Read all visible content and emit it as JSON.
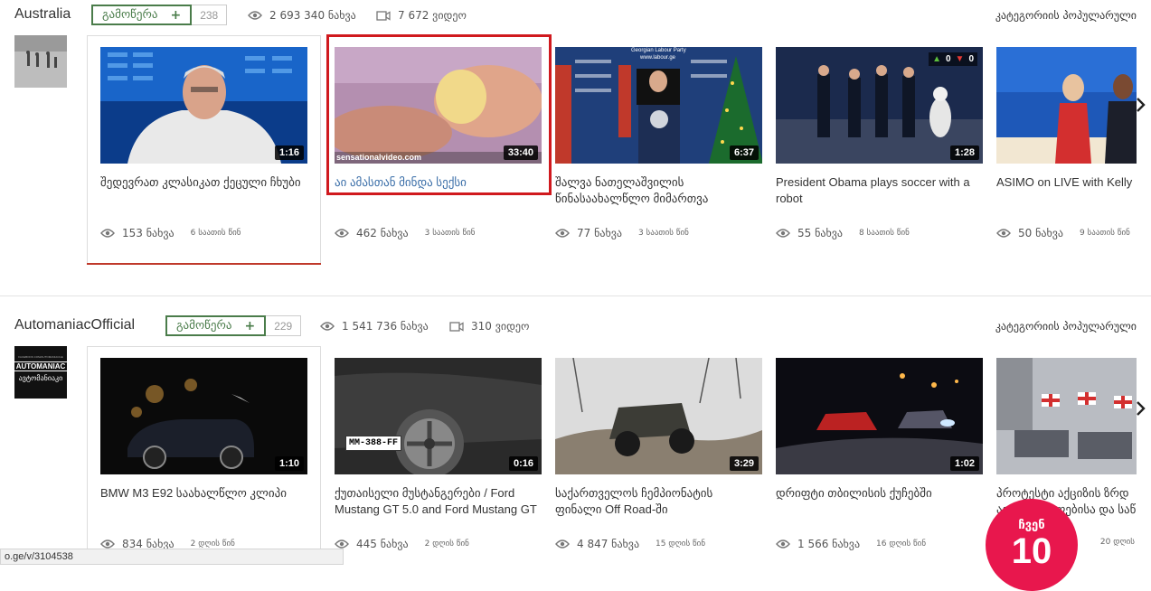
{
  "sections": [
    {
      "channel": "Australia",
      "subscribe_label": "გამოწერა",
      "subscribe_plus": "+",
      "subscriber_count": "238",
      "total_views": "2 693 340 ნახვა",
      "video_count": "7 672 ვიდეო",
      "popular_link": "კატეგორიის პოპულარული",
      "videos": [
        {
          "title": "შედევრათ კლასიკათ ქეცული ჩხუბი",
          "duration": "1:16",
          "views": "153 ნახვა",
          "ago": "6 საათის წინ"
        },
        {
          "title": "აი ამასთან მინდა სექსი",
          "duration": "33:40",
          "views": "462 ნახვა",
          "ago": "3 საათის წინ"
        },
        {
          "title": "შალვა ნათელაშვილის წინასაახალწლო მიმართვა",
          "duration": "6:37",
          "views": "77 ნახვა",
          "ago": "3 საათის წინ"
        },
        {
          "title": "President Obama plays soccer with a robot",
          "duration": "1:28",
          "views": "55 ნახვა",
          "ago": "8 საათის წინ",
          "likes": "0",
          "dislikes": "0"
        },
        {
          "title": "ASIMO on LIVE with Kelly",
          "duration": "",
          "views": "50 ნახვა",
          "ago": "9 საათის წინ"
        }
      ]
    },
    {
      "channel": "AutomaniacOfficial",
      "avatar_text_top": "FACEBOOK.COM/AUTOMANIACGE",
      "avatar_text_main": "AUTOMANIAC",
      "avatar_text_sub": "ავტომანიაკი",
      "subscribe_label": "გამოწერა",
      "subscribe_plus": "+",
      "subscriber_count": "229",
      "total_views": "1 541 736 ნახვა",
      "video_count": "310 ვიდეო",
      "popular_link": "კატეგორიის პოპულარული",
      "videos": [
        {
          "title": "BMW M3 E92 საახალწლო კლიპი",
          "duration": "1:10",
          "views": "834 ნახვა",
          "ago": "2 დღის წინ"
        },
        {
          "title": "ქუთაისელი მუსტანგერები / Ford Mustang GT 5.0 and Ford Mustang GT",
          "duration": "0:16",
          "views": "445 ნახვა",
          "ago": "2 დღის წინ",
          "plate": "MM-388-FF"
        },
        {
          "title": "საქართველოს ჩემპიონატის ფინალი Off Road-ში",
          "duration": "3:29",
          "views": "4 847 ნახვა",
          "ago": "15 დღის წინ"
        },
        {
          "title": "დრიფტი თბილისის ქუჩებში",
          "duration": "1:02",
          "views": "1 566 ნახვა",
          "ago": "16 დღის წინ"
        },
        {
          "title": "პროტესტი აქციზის ზრდ ავტომობილებისა და საწ",
          "duration": "",
          "views": "",
          "ago": "20 დღის"
        }
      ]
    }
  ],
  "thumb_texts": {
    "watermark": "sensationalvideo.com",
    "georgia_labour": "Georgian Labour Party",
    "labour_site": "www.labour.ge"
  },
  "status_url": "o.ge/v/3104538",
  "badge": {
    "line1": "ჩვენ",
    "line2": "10"
  },
  "colors": {
    "accent_green": "#4a7c4a",
    "highlight_red": "#d0191e",
    "badge_pink": "#e8174d",
    "active_title": "#3a6ea8"
  }
}
